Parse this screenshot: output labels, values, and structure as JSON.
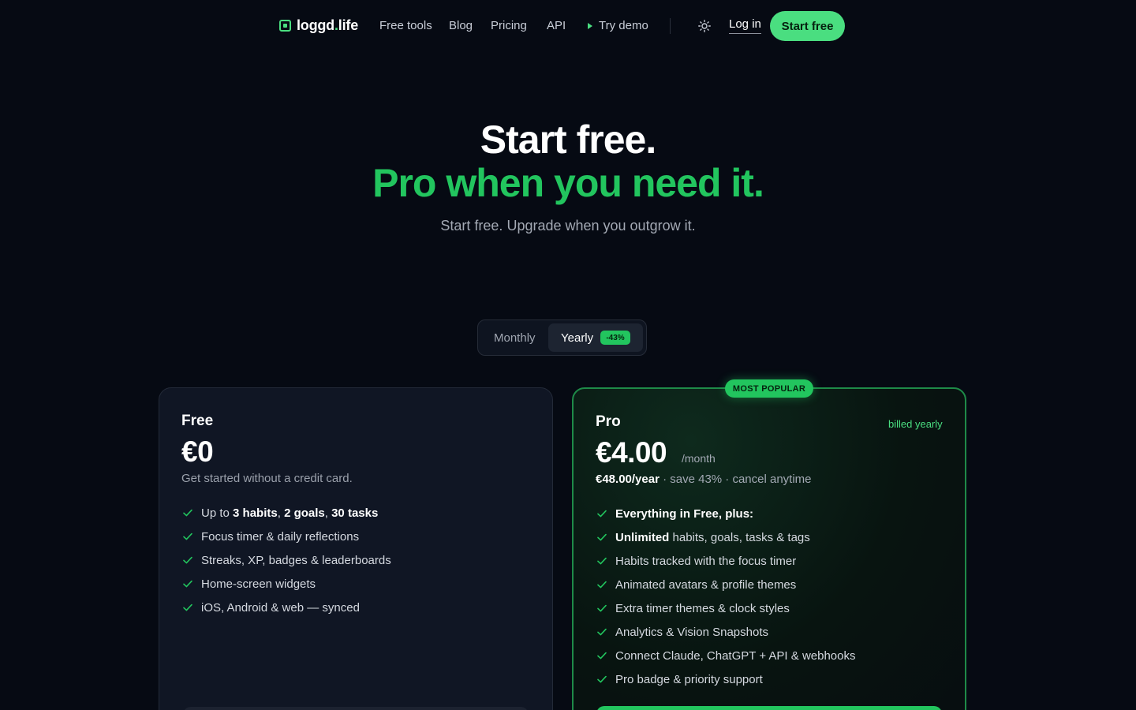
{
  "nav": {
    "logo_main": "loggd",
    "logo_dot": ".",
    "logo_end": "life",
    "links": [
      "Free tools",
      "Blog",
      "Pricing",
      "API"
    ],
    "demo": "Try demo",
    "login": "Log in",
    "start": "Start free"
  },
  "hero": {
    "line1": "Start free.",
    "line2": "Pro when you need it.",
    "subtitle": "Start free. Upgrade when you outgrow it."
  },
  "billing_toggle": {
    "monthly": "Monthly",
    "yearly": "Yearly",
    "save": "-43%",
    "selected": "Yearly"
  },
  "plans": {
    "free": {
      "name": "Free",
      "price": "€0",
      "desc": "Get started without a credit card.",
      "features": [
        {
          "pre": "Up to ",
          "parts": [
            [
              "3 habits",
              true
            ],
            [
              ", ",
              false
            ],
            [
              "2 goals",
              true
            ],
            [
              ", ",
              false
            ],
            [
              "30 tasks",
              true
            ]
          ]
        },
        {
          "text": "Focus timer & daily reflections"
        },
        {
          "text": "Streaks, XP, badges & leaderboards"
        },
        {
          "text": "Home-screen widgets"
        },
        {
          "text": "iOS, Android & web — synced"
        }
      ]
    },
    "pro": {
      "badge": "MOST POPULAR",
      "name": "Pro",
      "billed": "billed yearly",
      "price": "€4.00",
      "per": "/month",
      "year_price": "€48.00/year",
      "year_rest": " · save 43% · cancel anytime",
      "features": [
        {
          "bold": "Everything in Free, plus:"
        },
        {
          "bold": "Unlimited",
          "text": " habits, goals, tasks & tags"
        },
        {
          "text": "Habits tracked with the focus timer"
        },
        {
          "text": "Animated avatars & profile themes"
        },
        {
          "text": "Extra timer themes & clock styles"
        },
        {
          "text": "Analytics & Vision Snapshots"
        },
        {
          "text": "Connect Claude, ChatGPT + API & webhooks"
        },
        {
          "text": "Pro badge & priority support"
        }
      ]
    }
  },
  "colors": {
    "accent": "#22c55e",
    "accent_light": "#4ade80",
    "background": "#060a13"
  }
}
